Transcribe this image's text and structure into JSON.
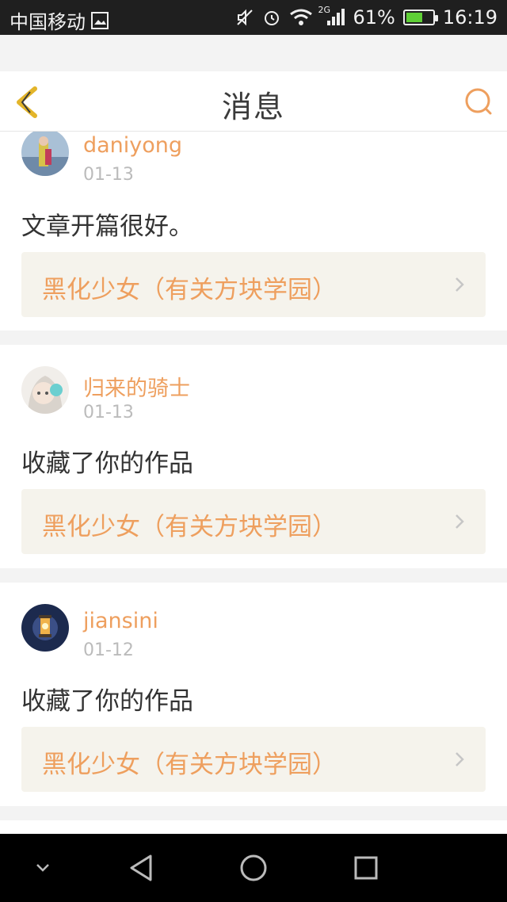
{
  "status_bar": {
    "carrier": "中国移动",
    "network": "2G",
    "battery_percent": "61%",
    "battery_level": 0.61,
    "time": "16:19"
  },
  "header": {
    "title": "消息",
    "back_icon": "chevron-left-icon",
    "search_icon": "search-icon"
  },
  "colors": {
    "accent": "#ee9f5e",
    "card_bg": "#f5f3ec",
    "back_icon": "#e3b52a"
  },
  "messages": [
    {
      "username": "daniyong",
      "date": "01-13",
      "text": "文章开篇很好。",
      "work_title": "黑化少女（有关方块学园）"
    },
    {
      "username": "归来的骑士",
      "date": "01-13",
      "text": "收藏了你的作品",
      "work_title": "黑化少女（有关方块学园）"
    },
    {
      "username": "jiansini",
      "date": "01-12",
      "text": "收藏了你的作品",
      "work_title": "黑化少女（有关方块学园）"
    }
  ],
  "system_nav": {
    "icons": [
      "chevron-down-icon",
      "back-triangle-icon",
      "home-circle-icon",
      "recents-square-icon"
    ]
  }
}
